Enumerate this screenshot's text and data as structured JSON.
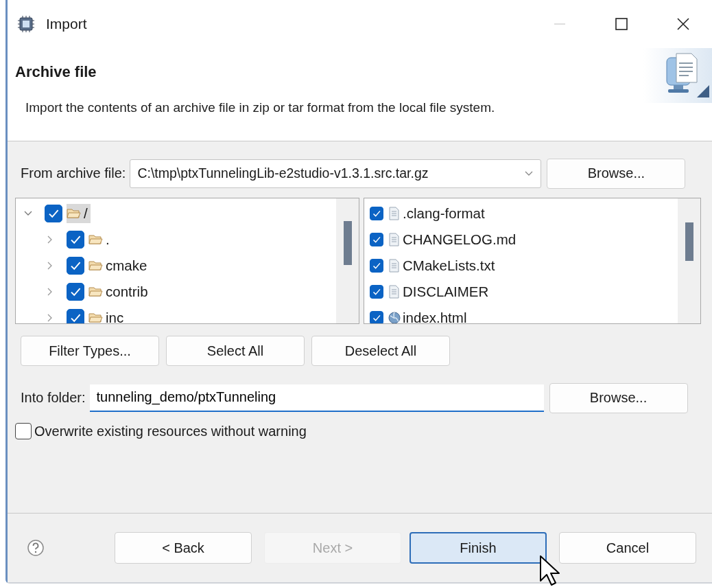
{
  "window": {
    "title": "Import"
  },
  "header": {
    "title": "Archive file",
    "description": "Import the contents of an archive file in zip or tar format from the local file system."
  },
  "archive": {
    "label": "From archive file:",
    "value": "C:\\tmp\\ptxTunnelingLib-e2studio-v1.3.1.src.tar.gz",
    "browse": "Browse..."
  },
  "tree": [
    {
      "label": "/",
      "checked": true,
      "expanded": true,
      "selected": true,
      "children": [
        {
          "label": ".",
          "checked": true,
          "expanded": false,
          "selected": false
        },
        {
          "label": "cmake",
          "checked": true,
          "expanded": false,
          "selected": false
        },
        {
          "label": "contrib",
          "checked": true,
          "expanded": false,
          "selected": false
        },
        {
          "label": "inc",
          "checked": true,
          "expanded": false,
          "selected": false
        }
      ]
    }
  ],
  "files": [
    {
      "name": ".clang-format",
      "checked": true,
      "kind": "file"
    },
    {
      "name": "CHANGELOG.md",
      "checked": true,
      "kind": "file"
    },
    {
      "name": "CMakeLists.txt",
      "checked": true,
      "kind": "file"
    },
    {
      "name": "DISCLAIMER",
      "checked": true,
      "kind": "file"
    },
    {
      "name": "index.html",
      "checked": true,
      "kind": "web"
    }
  ],
  "selection_buttons": [
    "Filter Types...",
    "Select All",
    "Deselect All"
  ],
  "folder": {
    "label": "Into folder:",
    "value": "tunneling_demo/ptxTunneling",
    "browse": "Browse...",
    "focused": true
  },
  "overwrite": {
    "label": "Overwrite existing resources without warning",
    "checked": false
  },
  "footer_buttons": [
    {
      "label": "< Back",
      "disabled": false,
      "default": false
    },
    {
      "label": "Next >",
      "disabled": true,
      "default": false
    },
    {
      "label": "Finish",
      "disabled": false,
      "default": true
    },
    {
      "label": "Cancel",
      "disabled": false,
      "default": false
    }
  ]
}
